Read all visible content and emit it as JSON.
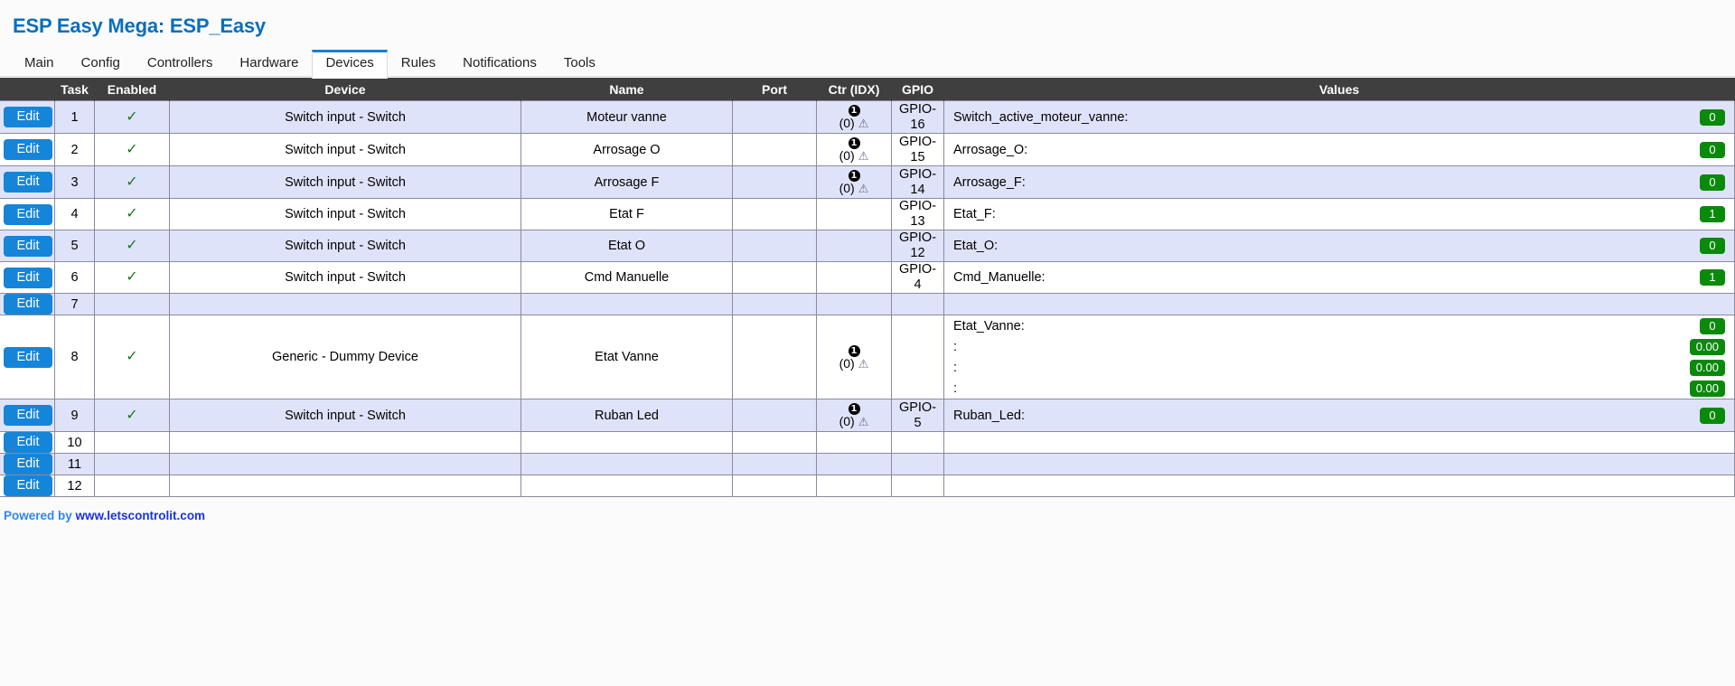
{
  "header": {
    "title": "ESP Easy Mega: ESP_Easy"
  },
  "tabs": [
    {
      "label": "Main",
      "active": false
    },
    {
      "label": "Config",
      "active": false
    },
    {
      "label": "Controllers",
      "active": false
    },
    {
      "label": "Hardware",
      "active": false
    },
    {
      "label": "Devices",
      "active": true
    },
    {
      "label": "Rules",
      "active": false
    },
    {
      "label": "Notifications",
      "active": false
    },
    {
      "label": "Tools",
      "active": false
    }
  ],
  "table": {
    "columns": [
      "",
      "Task",
      "Enabled",
      "Device",
      "Name",
      "Port",
      "Ctr (IDX)",
      "GPIO",
      "Values"
    ],
    "edit_label": "Edit",
    "enabled_glyph": "✓",
    "ctr_glyph": "1",
    "ctr_idx_text": "(0)",
    "warn_glyph": "⚠",
    "rows": [
      {
        "task": "1",
        "enabled": true,
        "device": "Switch input - Switch",
        "name": "Moteur vanne",
        "port": "",
        "ctr": true,
        "gpio": "GPIO-16",
        "values": [
          {
            "label": "Switch_active_moteur_vanne:",
            "value": "0"
          }
        ]
      },
      {
        "task": "2",
        "enabled": true,
        "device": "Switch input - Switch",
        "name": "Arrosage O",
        "port": "",
        "ctr": true,
        "gpio": "GPIO-15",
        "values": [
          {
            "label": "Arrosage_O:",
            "value": "0"
          }
        ]
      },
      {
        "task": "3",
        "enabled": true,
        "device": "Switch input - Switch",
        "name": "Arrosage F",
        "port": "",
        "ctr": true,
        "gpio": "GPIO-14",
        "values": [
          {
            "label": "Arrosage_F:",
            "value": "0"
          }
        ]
      },
      {
        "task": "4",
        "enabled": true,
        "device": "Switch input - Switch",
        "name": "Etat F",
        "port": "",
        "ctr": false,
        "gpio": "GPIO-13",
        "values": [
          {
            "label": "Etat_F:",
            "value": "1"
          }
        ]
      },
      {
        "task": "5",
        "enabled": true,
        "device": "Switch input - Switch",
        "name": "Etat O",
        "port": "",
        "ctr": false,
        "gpio": "GPIO-12",
        "values": [
          {
            "label": "Etat_O:",
            "value": "0"
          }
        ]
      },
      {
        "task": "6",
        "enabled": true,
        "device": "Switch input - Switch",
        "name": "Cmd Manuelle",
        "port": "",
        "ctr": false,
        "gpio": "GPIO-4",
        "values": [
          {
            "label": "Cmd_Manuelle:",
            "value": "1"
          }
        ]
      },
      {
        "task": "7",
        "enabled": false,
        "device": "",
        "name": "",
        "port": "",
        "ctr": false,
        "gpio": "",
        "values": []
      },
      {
        "task": "8",
        "enabled": true,
        "device": "Generic - Dummy Device",
        "name": "Etat Vanne",
        "port": "",
        "ctr": true,
        "gpio": "",
        "values": [
          {
            "label": "Etat_Vanne:",
            "value": "0"
          },
          {
            "label": ":",
            "value": "0.00"
          },
          {
            "label": ":",
            "value": "0.00"
          },
          {
            "label": ":",
            "value": "0.00"
          }
        ]
      },
      {
        "task": "9",
        "enabled": true,
        "device": "Switch input - Switch",
        "name": "Ruban Led",
        "port": "",
        "ctr": true,
        "gpio": "GPIO-5",
        "values": [
          {
            "label": "Ruban_Led:",
            "value": "0"
          }
        ]
      },
      {
        "task": "10",
        "enabled": false,
        "device": "",
        "name": "",
        "port": "",
        "ctr": false,
        "gpio": "",
        "values": []
      },
      {
        "task": "11",
        "enabled": false,
        "device": "",
        "name": "",
        "port": "",
        "ctr": false,
        "gpio": "",
        "values": []
      },
      {
        "task": "12",
        "enabled": false,
        "device": "",
        "name": "",
        "port": "",
        "ctr": false,
        "gpio": "",
        "values": []
      }
    ]
  },
  "footer": {
    "powered_by": "Powered by",
    "link": "www.letscontrolit.com"
  },
  "colors": {
    "title": "#0a6ebd",
    "tab_active_border": "#1a7fd4",
    "header_bg": "#3f3f3f",
    "row_alt_bg": "#dfe3fa",
    "edit_button": "#1585da",
    "value_badge": "#0a8a0a",
    "check": "#1a7a1a",
    "footer_link": "#1733e0"
  }
}
